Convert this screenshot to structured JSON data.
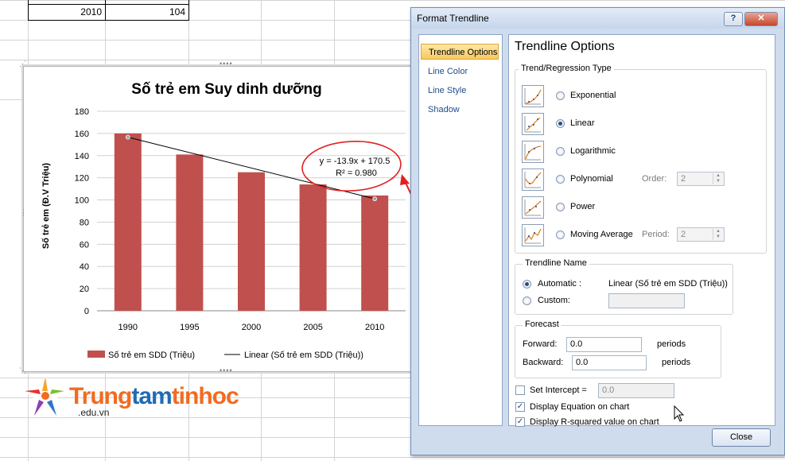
{
  "sheet": {
    "row_year": "2010",
    "row_value": "104"
  },
  "chart": {
    "title": "Số trẻ em Suy dinh dưỡng",
    "ylabel": "Số trẻ em (Đ.V Triệu)",
    "y_ticks": [
      "0",
      "20",
      "40",
      "60",
      "80",
      "100",
      "120",
      "140",
      "160",
      "180"
    ],
    "categories": [
      "1990",
      "1995",
      "2000",
      "2005",
      "2010"
    ],
    "legend_series": "Số trẻ em SDD (Triệu)",
    "legend_trend": "Linear (Số trẻ em SDD (Triệu))",
    "equation": "y = -13.9x + 170.5",
    "r2": "R² = 0.980",
    "bar_color": "#c0504d",
    "annotation_color": "#e32020"
  },
  "chart_data": {
    "type": "bar",
    "title": "Số trẻ em Suy dinh dưỡng",
    "xlabel": "",
    "ylabel": "Số trẻ em (Đ.V Triệu)",
    "categories": [
      "1990",
      "1995",
      "2000",
      "2005",
      "2010"
    ],
    "series": [
      {
        "name": "Số trẻ em SDD (Triệu)",
        "values": [
          160,
          141,
          125,
          114,
          104
        ]
      }
    ],
    "trendline": {
      "name": "Linear (Số trẻ em SDD (Triệu))",
      "slope": -13.9,
      "intercept": 170.5,
      "r2": 0.98
    },
    "ylim": [
      0,
      180
    ],
    "grid": true,
    "legend": "bottom"
  },
  "logo": {
    "brand_trung": "Trung",
    "brand_tam": "tam",
    "brand_tinhoc": "tinhoc",
    "domain": ".edu.vn"
  },
  "dialog": {
    "title": "Format Trendline",
    "help": "?",
    "close_x": "✕",
    "nav": [
      "Trendline Options",
      "Line Color",
      "Line Style",
      "Shadow"
    ],
    "panel_title": "Trendline Options",
    "type_group": "Trend/Regression Type",
    "types": {
      "exponential": "Exponential",
      "linear": "Linear",
      "logarithmic": "Logarithmic",
      "polynomial": "Polynomial",
      "power": "Power",
      "moving_average": "Moving Average"
    },
    "order_label": "Order:",
    "order_value": "2",
    "period_label": "Period:",
    "period_value": "2",
    "name_group": "Trendline Name",
    "automatic_label": "Automatic :",
    "automatic_value": "Linear (Số trẻ em SDD (Triệu))",
    "custom_label": "Custom:",
    "forecast_group": "Forecast",
    "forward_label": "Forward:",
    "forward_value": "0.0",
    "backward_label": "Backward:",
    "backward_value": "0.0",
    "periods": "periods",
    "set_intercept_label": "Set Intercept =",
    "intercept_value": "0.0",
    "display_equation": "Display Equation on chart",
    "display_r2": "Display R-squared value on chart",
    "close_button": "Close",
    "selected_type": "linear"
  }
}
